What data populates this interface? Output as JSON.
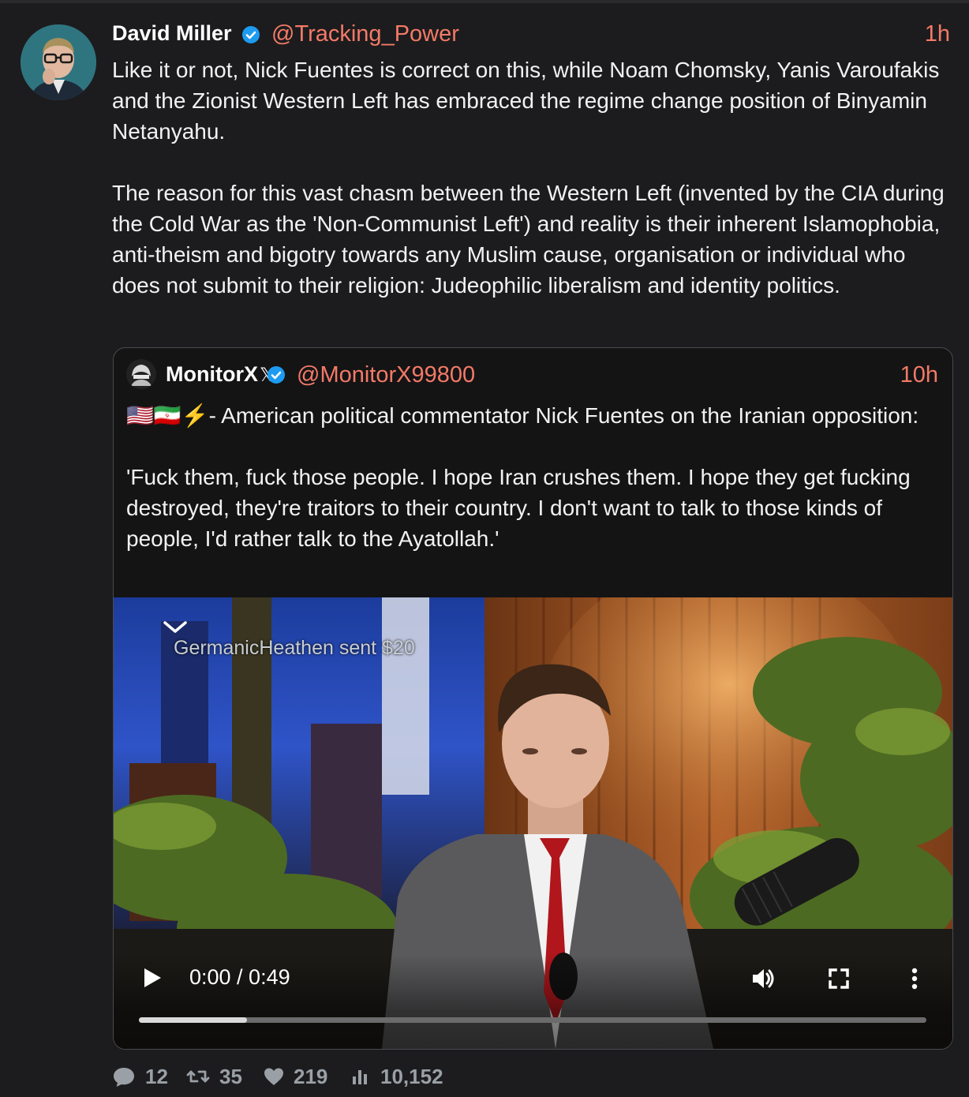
{
  "tweet": {
    "author_name": "David Miller",
    "author_handle": "@Tracking_Power",
    "time": "1h",
    "text": "Like it or not, Nick Fuentes is correct on this, while Noam Chomsky, Yanis Varoufakis and the Zionist Western Left has embraced the regime change position of Binyamin Netanyahu.\n\nThe reason for this vast chasm between the Western Left (invented by the CIA during the Cold War as the 'Non-Communist Left') and reality is their inherent Islamophobia, anti-theism and bigotry towards any Muslim cause, organisation or individual who does not submit to their religion: Judeophilic liberalism and identity politics."
  },
  "quote": {
    "author_name": "MonitorX",
    "author_handle": "@MonitorX99800",
    "time": "10h",
    "text": "🇺🇸🇮🇷⚡- American political commentator Nick Fuentes on the Iranian opposition:\n\n'Fuck them, fuck those people. I hope Iran crushes them. I hope they get fucking destroyed, they're traitors to their country. I don't want to talk to those kinds of people, I'd rather talk to the Ayatollah.'"
  },
  "video": {
    "overlay_text": "GermanicHeathen sent $20",
    "time_display": "0:00 / 0:49",
    "progress_fraction": 0.137,
    "icons": [
      "chevron-down-icon",
      "play-icon",
      "volume-icon",
      "fullscreen-icon",
      "more-options-icon"
    ]
  },
  "actions": {
    "replies": "12",
    "reposts": "35",
    "likes": "219",
    "views": "10,152"
  },
  "colors": {
    "background": "#1c1c1e",
    "accent": "#f47a67",
    "verified": "#1d9bf0",
    "muted": "#9aa0a6"
  }
}
